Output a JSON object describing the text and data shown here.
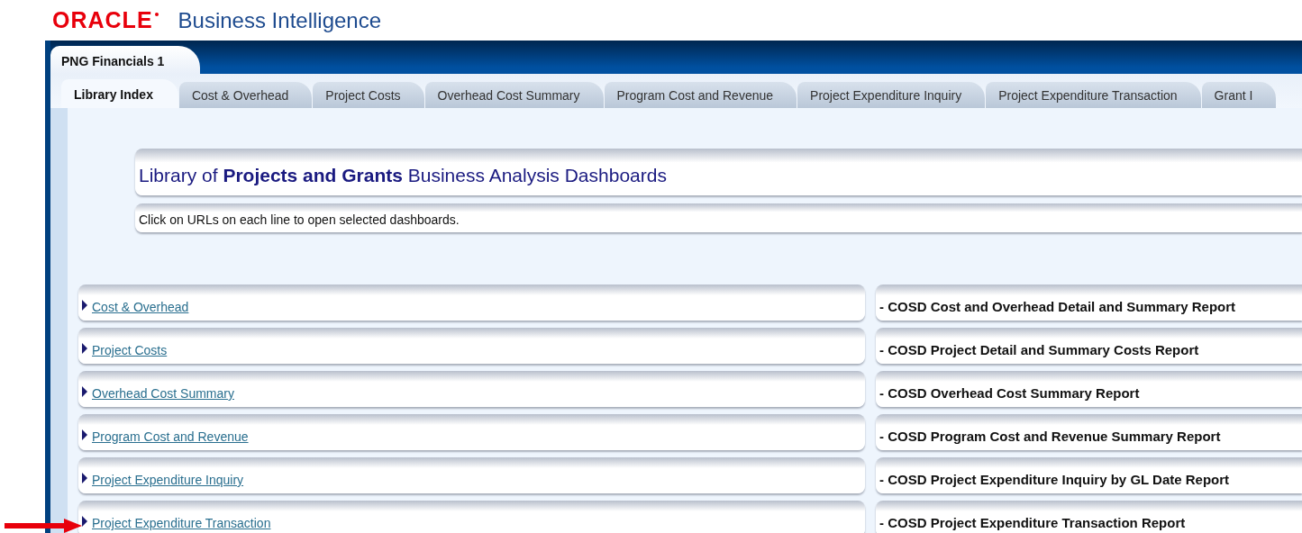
{
  "header": {
    "logo": "ORACLE",
    "product": "Business Intelligence"
  },
  "page_tabs": [
    {
      "label": "PNG Financials 1",
      "selected": true
    }
  ],
  "tabs": [
    {
      "label": "Library Index",
      "selected": true
    },
    {
      "label": "Cost & Overhead",
      "selected": false
    },
    {
      "label": "Project Costs",
      "selected": false
    },
    {
      "label": "Overhead Cost Summary",
      "selected": false
    },
    {
      "label": "Program Cost and Revenue",
      "selected": false
    },
    {
      "label": "Project Expenditure Inquiry",
      "selected": false
    },
    {
      "label": "Project Expenditure Transaction",
      "selected": false
    },
    {
      "label": "Grant I",
      "selected": false
    }
  ],
  "title": "Library of **Projects and Grants** Business Analysis Dashboards",
  "instruction": "Click on URLs on each line to open selected dashboards.",
  "library": [
    {
      "link": "Cost & Overhead",
      "description": "- COSD Cost and Overhead Detail and Summary Report",
      "pointed": false
    },
    {
      "link": "Project Costs",
      "description": "- COSD Project Detail and Summary Costs Report",
      "pointed": false
    },
    {
      "link": "Overhead Cost Summary",
      "description": "- COSD Overhead Cost Summary Report",
      "pointed": false
    },
    {
      "link": "Program Cost and Revenue",
      "description": "- COSD Program Cost and Revenue Summary Report",
      "pointed": false
    },
    {
      "link": "Project Expenditure Inquiry",
      "description": "- COSD Project Expenditure Inquiry by GL Date Report",
      "pointed": false
    },
    {
      "link": "Project Expenditure Transaction",
      "description": "- COSD Project Expenditure Transaction Report",
      "pointed": true
    }
  ]
}
